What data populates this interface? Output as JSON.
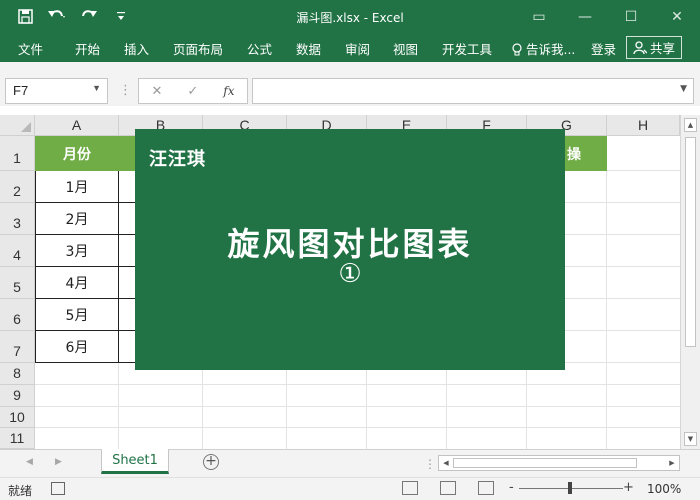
{
  "window": {
    "title": "漏斗图.xlsx - Excel",
    "qat": {
      "save_icon": "save-icon",
      "undo_icon": "undo-icon",
      "redo_icon": "redo-icon",
      "customize_icon": "customize-qat-icon"
    },
    "controls": {
      "ribbon_display": "▭",
      "minimize": "—",
      "maximize": "☐",
      "close": "✕"
    }
  },
  "ribbon": {
    "tabs": [
      "文件",
      "开始",
      "插入",
      "页面布局",
      "公式",
      "数据",
      "审阅",
      "视图",
      "开发工具"
    ],
    "tell_me": "告诉我...",
    "sign_in": "登录",
    "share": "共享"
  },
  "formula_bar": {
    "name_box": "F7",
    "cancel": "✕",
    "enter": "✓",
    "fx": "fx",
    "value": ""
  },
  "columns": [
    "A",
    "B",
    "C",
    "D",
    "E",
    "F",
    "G",
    "H"
  ],
  "rows": [
    "1",
    "2",
    "3",
    "4",
    "5",
    "6",
    "7",
    "8",
    "9",
    "10",
    "11"
  ],
  "table": {
    "header": "月份",
    "months": [
      "1月",
      "2月",
      "3月",
      "4月",
      "5月",
      "6月"
    ],
    "g1_partial": "操"
  },
  "overlay": {
    "brand": "汪汪琪",
    "title": "旋风图对比图表",
    "number": "①"
  },
  "sheets": {
    "active": "Sheet1",
    "add": "+"
  },
  "status": {
    "ready": "就绪",
    "zoom": "100%",
    "zoom_minus": "-",
    "zoom_plus": "+"
  },
  "colors": {
    "accent": "#217346",
    "header_fill": "#70ad47"
  }
}
